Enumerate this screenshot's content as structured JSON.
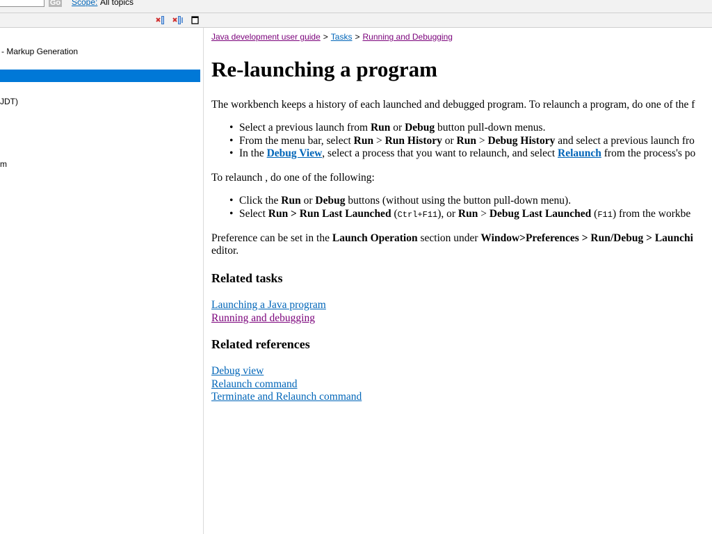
{
  "search": {
    "value": "",
    "go_label": "Go",
    "scope_label": "Scope:",
    "scope_value": "All topics"
  },
  "toolbar": {
    "icons": [
      "remove-search-results-icon",
      "remove-all-icon",
      "maximize-icon"
    ]
  },
  "nav": {
    "items": [
      {
        "label": "- Markup Generation"
      },
      {
        "label": ""
      },
      {
        "label": "JDT)"
      },
      {
        "label": "m"
      }
    ],
    "selected_index": 1
  },
  "breadcrumb": {
    "items": [
      "Java development user guide",
      "Tasks",
      "Running and Debugging"
    ],
    "separator": ">"
  },
  "page": {
    "title": "Re-launching a program",
    "intro": "The workbench keeps a history of each launched and debugged program. To relaunch a program, do one of the f",
    "list1": [
      [
        "Select a previous launch from ",
        "Run",
        " or ",
        "Debug",
        " button pull-down menus."
      ],
      [
        "From the menu bar, select ",
        "Run",
        " > ",
        "Run History",
        " or ",
        "Run",
        " > ",
        "Debug History",
        " and select a previous launch fro"
      ],
      [
        "In the ",
        "Debug View",
        ", select a process that you want to relaunch, and select ",
        "Relaunch",
        " from the process's po"
      ]
    ],
    "relaunch_intro": "To relaunch , do one of the following:",
    "list2": [
      [
        "Click the ",
        "Run",
        " or ",
        "Debug",
        " buttons (without using the button pull-down menu)."
      ],
      [
        "Select ",
        "Run > Run Last Launched",
        " (",
        "Ctrl+F11",
        "), or ",
        "Run",
        " > ",
        "Debug Last Launched",
        " (",
        "F11",
        ") from the workbe"
      ]
    ],
    "pref_line1": [
      "Preference can be set in the ",
      "Launch Operation",
      " section under ",
      "Window>Preferences > Run/Debug > Launchi"
    ],
    "pref_line2": "editor.",
    "related_tasks_heading": "Related tasks",
    "related_tasks": [
      "Launching a Java program",
      "Running and debugging"
    ],
    "related_refs_heading": "Related references",
    "related_refs": [
      "Debug view",
      "Relaunch command",
      "Terminate and Relaunch command"
    ]
  },
  "colors": {
    "link": "#0065b8",
    "visited": "#7a007a",
    "selection": "#0078d7",
    "chrome": "#f2f2f2"
  }
}
